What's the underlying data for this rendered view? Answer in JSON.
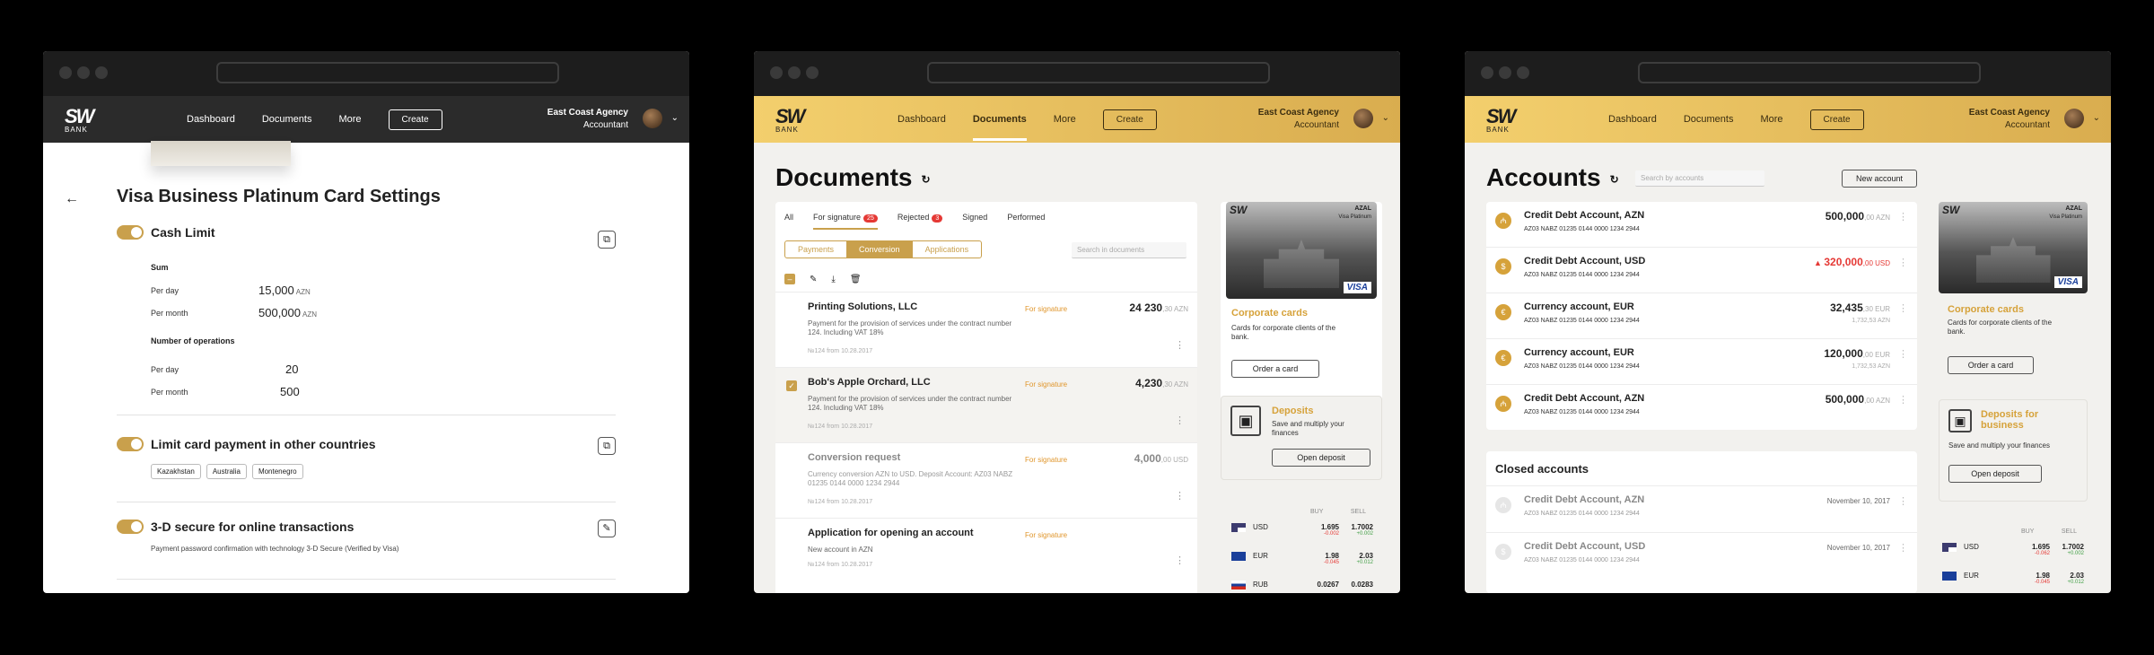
{
  "common": {
    "brand": "SW",
    "brand_sub": "BANK",
    "nav": [
      "Dashboard",
      "Documents",
      "More"
    ],
    "create": "Create",
    "agency": "East Coast Agency",
    "role": "Accountant"
  },
  "w1": {
    "title": "Visa Business Platinum Card Settings",
    "cash": {
      "label": "Cash Limit",
      "sum": "Sum",
      "per_day": "Per day",
      "per_month": "Per month",
      "day_v": "15,000",
      "month_v": "500,000",
      "cur": "AZN",
      "ops": "Number of operations",
      "ops_day": "20",
      "ops_month": "500"
    },
    "limit": {
      "label": "Limit card payment in other countries",
      "chips": [
        "Kazakhstan",
        "Australia",
        "Montenegro"
      ]
    },
    "secure": {
      "label": "3-D secure for online transactions",
      "desc": "Payment password confirmation with technology 3-D Secure (Verified by Visa)"
    }
  },
  "w2": {
    "title": "Documents",
    "tabs": [
      {
        "l": "All"
      },
      {
        "l": "For signature",
        "b": "25"
      },
      {
        "l": "Rejected",
        "b": "3"
      },
      {
        "l": "Signed"
      },
      {
        "l": "Performed"
      }
    ],
    "seg": [
      "Payments",
      "Conversion",
      "Applications"
    ],
    "search": "Search in documents",
    "docs": [
      {
        "t": "Printing Solutions, LLC",
        "d": "Payment for the provision of services under the contract number 124. Including VAT 18%",
        "n": "№124 from 10.28.2017",
        "s": "For signature",
        "a": "24 230",
        "f": ",30 AZN"
      },
      {
        "t": "Bob's Apple Orchard, LLC",
        "d": "Payment for the provision of services under the contract number 124. Including VAT 18%",
        "n": "№124 from 10.28.2017",
        "s": "For signature",
        "a": "4,230",
        "f": ",30 AZN"
      },
      {
        "t": "Conversion request",
        "d": "Currency conversion AZN to USD. Deposit Account: AZ03 NABZ 01235 0144 0000 1234 2944",
        "n": "№124 from 10.28.2017",
        "s": "For signature",
        "a": "4,000",
        "f": ",00 USD"
      },
      {
        "t": "Application for opening an account",
        "d": "New account in AZN",
        "n": "№124 from 10.28.2017",
        "s": "For signature",
        "a": "",
        "f": ""
      }
    ],
    "card": {
      "azal": "AZAL",
      "vp": "Visa Platinum",
      "visa": "VISA",
      "title": "Corporate cards",
      "desc": "Cards for corporate clients of the bank.",
      "btn": "Order a card"
    },
    "dep": {
      "title": "Deposits",
      "desc": "Save and multiply your finances",
      "btn": "Open deposit"
    },
    "fx": {
      "buy": "BUY",
      "sell": "SELL",
      "rows": [
        {
          "c": "USD",
          "b": "1.695",
          "bd": "-0.002",
          "s": "1.7002",
          "sd": "+0.002"
        },
        {
          "c": "EUR",
          "b": "1.98",
          "bd": "-0.045",
          "s": "2.03",
          "sd": "+0.012"
        },
        {
          "c": "RUB",
          "b": "0.0267",
          "bd": "",
          "s": "0.0283",
          "sd": ""
        }
      ]
    }
  },
  "w3": {
    "title": "Accounts",
    "search": "Search by accounts",
    "new": "New account",
    "accounts": [
      {
        "n": "Credit Debt Account, AZN",
        "ib": "AZ03 NABZ 01235 0144 0000 1234 2944",
        "a": "500,000",
        "f": ",00 AZN",
        "sub": "",
        "ic": "₼",
        "neg": false
      },
      {
        "n": "Credit Debt Account, USD",
        "ib": "AZ03 NABZ 01235 0144 0000 1234 2944",
        "a": "320,000",
        "f": ",00 USD",
        "sub": "",
        "ic": "$",
        "neg": true
      },
      {
        "n": "Currency account, EUR",
        "ib": "AZ03 NABZ 01235 0144 0000 1234 2944",
        "a": "32,435",
        "f": ",30 EUR",
        "sub": "1,732,53 AZN",
        "ic": "€",
        "neg": false
      },
      {
        "n": "Currency account, EUR",
        "ib": "AZ03 NABZ 01235 0144 0000 1234 2944",
        "a": "120,000",
        "f": ",00 EUR",
        "sub": "1,732,53 AZN",
        "ic": "€",
        "neg": false
      },
      {
        "n": "Credit Debt Account, AZN",
        "ib": "AZ03 NABZ 01235 0144 0000 1234 2944",
        "a": "500,000",
        "f": ",00 AZN",
        "sub": "",
        "ic": "₼",
        "neg": false
      }
    ],
    "closed_title": "Closed accounts",
    "closed": [
      {
        "n": "Credit Debt Account, AZN",
        "ib": "AZ03 NABZ 01235 0144 0000 1234 2944",
        "d": "November 10, 2017",
        "ic": "₼"
      },
      {
        "n": "Credit Debt Account, USD",
        "ib": "AZ03 NABZ 01235 0144 0000 1234 2944",
        "d": "November 10, 2017",
        "ic": "$"
      }
    ],
    "card": {
      "title": "Corporate cards",
      "desc": "Cards for corporate clients of the bank.",
      "btn": "Order a card"
    },
    "dep": {
      "title": "Deposits for business",
      "desc": "Save and multiply your finances",
      "btn": "Open deposit"
    },
    "fx": {
      "buy": "BUY",
      "sell": "SELL",
      "rows": [
        {
          "c": "USD",
          "b": "1.695",
          "bd": "-0.062",
          "s": "1.7002",
          "sd": "+0.002"
        },
        {
          "c": "EUR",
          "b": "1.98",
          "bd": "-0.045",
          "s": "2.03",
          "sd": "+0.012"
        }
      ]
    }
  },
  "colors": {
    "gold": "#c9a04c",
    "dark_header": "#2b2b2b",
    "negative": "#e53935",
    "positive": "#43a047"
  }
}
